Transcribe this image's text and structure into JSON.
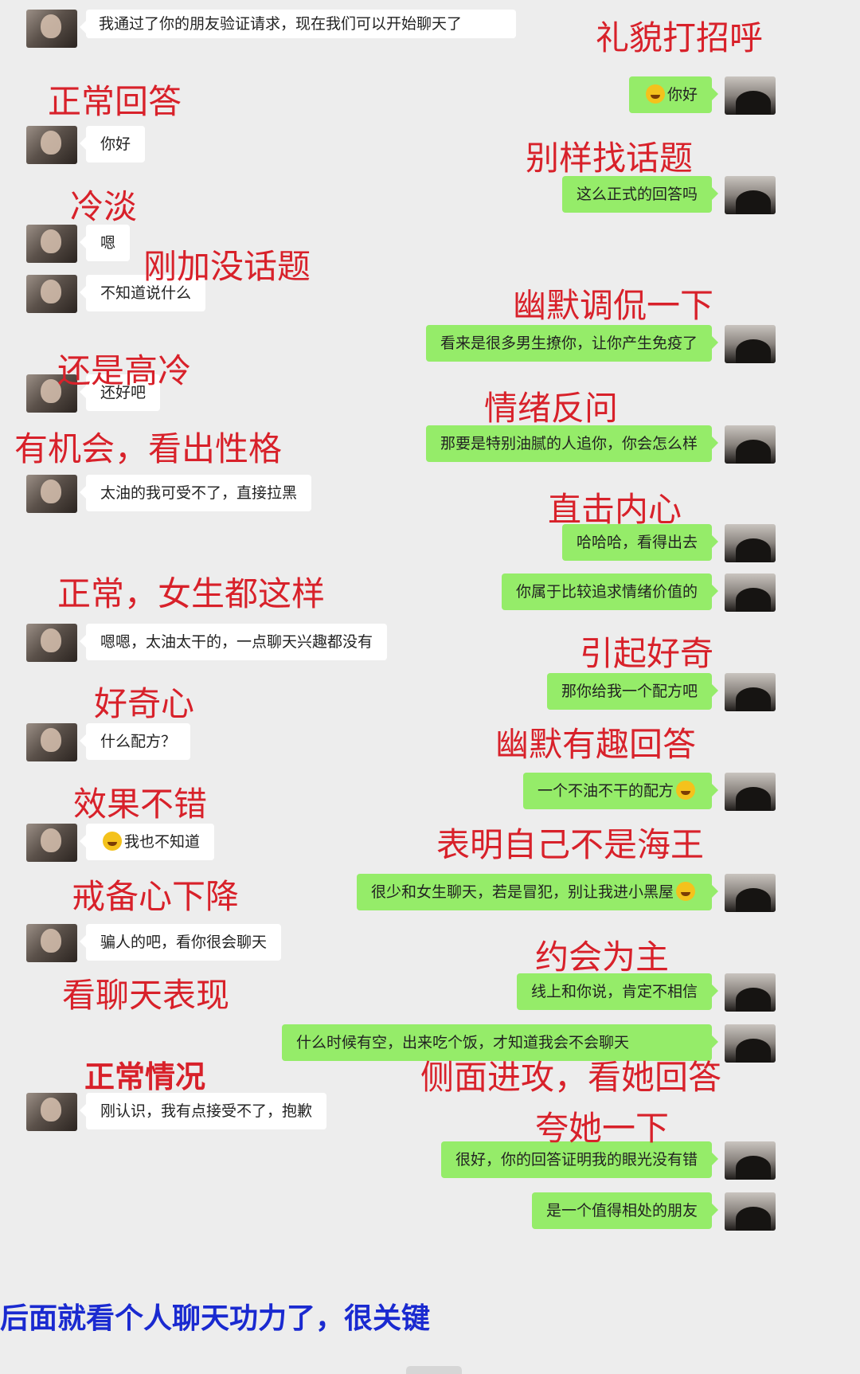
{
  "messages": [
    {
      "side": "left",
      "text": "我通过了你的朋友验证请求，现在我们可以开始聊天了"
    },
    {
      "side": "right",
      "text": "你好",
      "emoji": "smile-emoji"
    },
    {
      "side": "left",
      "text": "你好"
    },
    {
      "side": "right",
      "text": "这么正式的回答吗"
    },
    {
      "side": "left",
      "text": "嗯"
    },
    {
      "side": "left",
      "text": "不知道说什么"
    },
    {
      "side": "right",
      "text": "看来是很多男生撩你，让你产生免疫了"
    },
    {
      "side": "left",
      "text": "还好吧"
    },
    {
      "side": "right",
      "text": "那要是特别油腻的人追你，你会怎么样"
    },
    {
      "side": "left",
      "text": "太油的我可受不了，直接拉黑"
    },
    {
      "side": "right",
      "text": "哈哈哈，看得出去"
    },
    {
      "side": "right",
      "text": "你属于比较追求情绪价值的"
    },
    {
      "side": "left",
      "text": "嗯嗯，太油太干的，一点聊天兴趣都没有"
    },
    {
      "side": "right",
      "text": "那你给我一个配方吧"
    },
    {
      "side": "left",
      "text": "什么配方？"
    },
    {
      "side": "right",
      "text": "一个不油不干的配方",
      "emoji": "grin-emoji"
    },
    {
      "side": "left",
      "text": "我也不知道",
      "emoji": "sweat-emoji"
    },
    {
      "side": "right",
      "text": "很少和女生聊天，若是冒犯，别让我进小黑屋",
      "emoji": "shy-emoji"
    },
    {
      "side": "left",
      "text": "骗人的吧，看你很会聊天"
    },
    {
      "side": "right",
      "text": "线上和你说，肯定不相信"
    },
    {
      "side": "right",
      "text": "什么时候有空，出来吃个饭，才知道我会不会聊天"
    },
    {
      "side": "left",
      "text": "刚认识，我有点接受不了，抱歉"
    },
    {
      "side": "right",
      "text": "很好，你的回答证明我的眼光没有错"
    },
    {
      "side": "right",
      "text": "是一个值得相处的朋友"
    }
  ],
  "annotations": [
    "礼貌打招呼",
    "正常回答",
    "别样找话题",
    "冷淡",
    "刚加没话题",
    "幽默调侃一下",
    "还是高冷",
    "情绪反问",
    "有机会，看出性格",
    "直击内心",
    "正常，女生都这样",
    "引起好奇",
    "好奇心",
    "幽默有趣回答",
    "效果不错",
    "表明自己不是海王",
    "戒备心下降",
    "约会为主",
    "看聊天表现",
    "侧面进攻，看她回答",
    "正常情况",
    "夸她一下"
  ],
  "footer": "后面就看个人聊天功力了，很关键",
  "colors": {
    "annotation": "#d8212a",
    "footer": "#1a2ad0",
    "bubble_right": "#95ec69",
    "bubble_left": "#ffffff",
    "background": "#ededed"
  }
}
